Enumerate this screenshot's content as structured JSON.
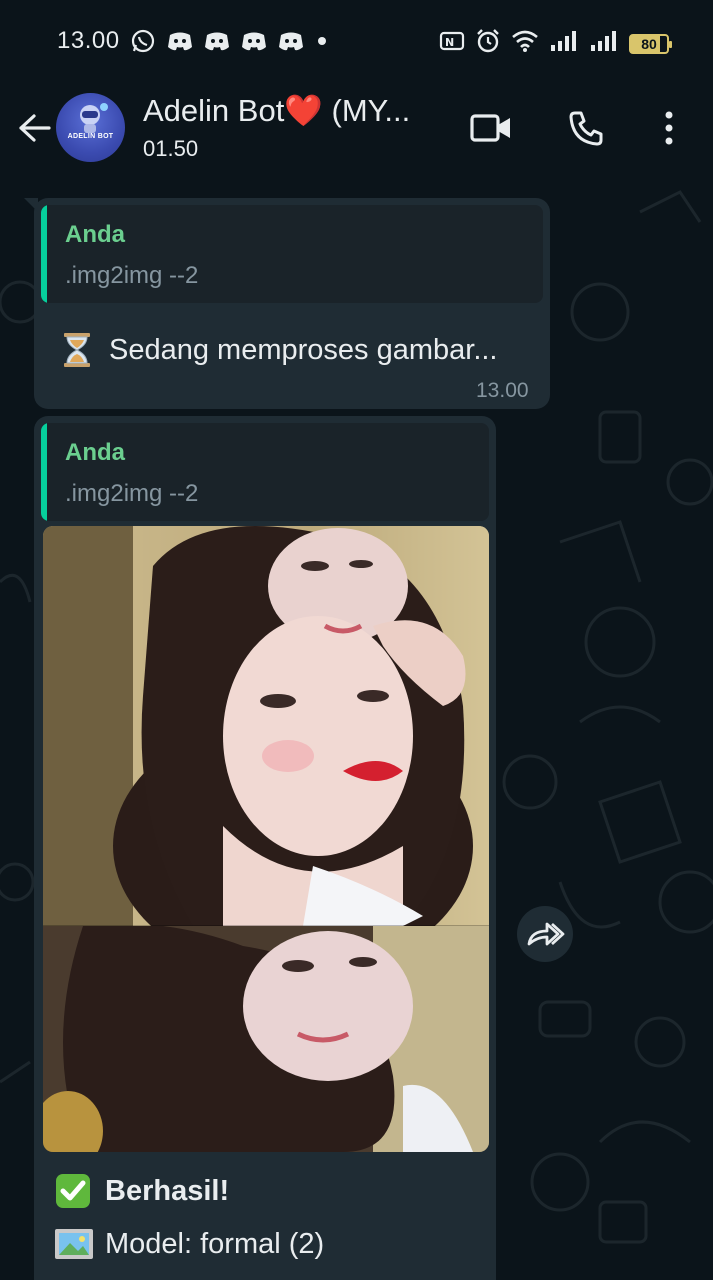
{
  "status_bar": {
    "time": "13.00",
    "notification_icons": [
      "whatsapp-icon",
      "discord-icon",
      "discord-icon",
      "discord-icon",
      "discord-icon",
      "dot-icon"
    ],
    "system_icons": [
      "nfc-icon",
      "alarm-icon",
      "wifi-icon",
      "signal-icon",
      "signal-icon"
    ],
    "battery": "80"
  },
  "header": {
    "contact_name": "Adelin Bot❤️ (MY...",
    "status": "01.50",
    "avatar_text": "ADELIN BOT",
    "actions": [
      "video-call-icon",
      "voice-call-icon",
      "more-options-icon"
    ]
  },
  "messages": [
    {
      "quote_author": "Anda",
      "quote_text": ".img2img --2",
      "text": "Sedang memproses gambar...",
      "emoji": "hourglass",
      "time": "13.00"
    },
    {
      "quote_author": "Anda",
      "quote_text": ".img2img --2",
      "has_image": true,
      "lines": [
        {
          "emoji": "check-mark",
          "text": "Berhasil!",
          "bold": true
        },
        {
          "emoji": "framed-picture",
          "text": "Model: formal (2)",
          "bold": false
        }
      ]
    }
  ],
  "colors": {
    "background": "#0b141a",
    "bubble": "#1f2c34",
    "quote_accent": "#06cf9c",
    "quote_author": "#6bcf8f",
    "secondary_text": "#8696a0"
  }
}
